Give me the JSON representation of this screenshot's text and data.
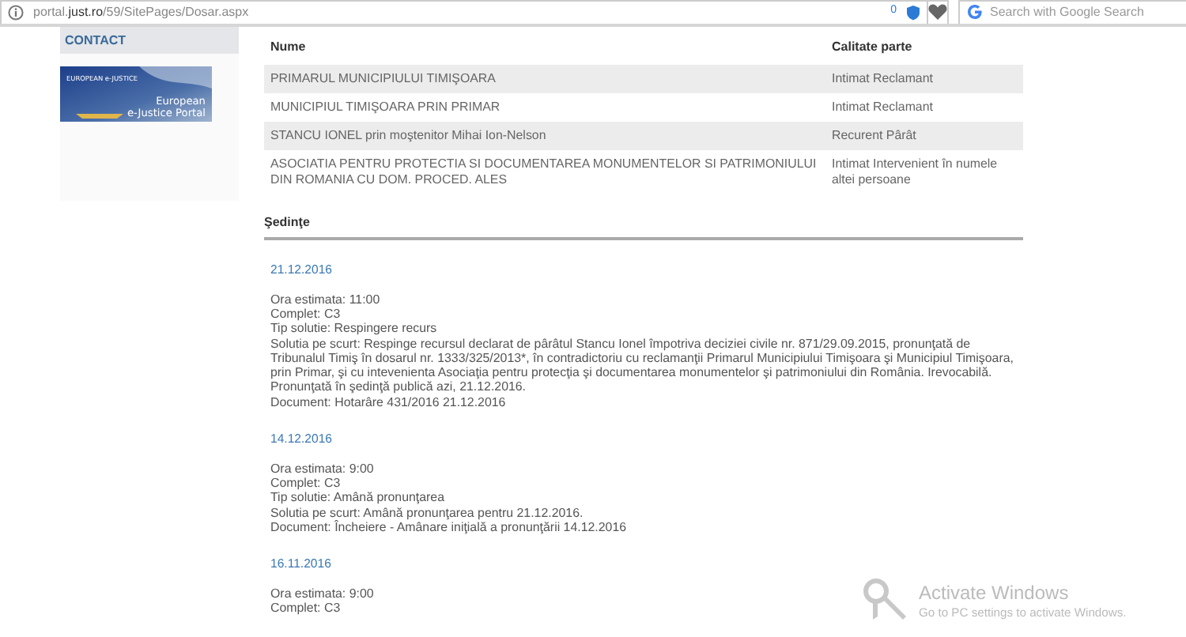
{
  "browser": {
    "url": "portal.**just.ro**/59/SitePages/Dosar.aspx",
    "badge_count": "0",
    "search_placeholder": "Search with Google Search"
  },
  "sidebar": {
    "heading": "CONTACT",
    "logo": {
      "small_text": "EUROPEAN e-JUSTICE",
      "title_line_1": "European",
      "title_line_2": "e-Justice Portal"
    }
  },
  "table": {
    "columns": [
      "Nume",
      "Calitate parte"
    ],
    "rows": [
      {
        "name": "PRIMARUL MUNICIPIULUI TIMIŞOARA",
        "role": "Intimat Reclamant"
      },
      {
        "name": "MUNICIPIUL TIMIŞOARA PRIN PRIMAR",
        "role": "Intimat Reclamant"
      },
      {
        "name": "STANCU IONEL prin moştenitor Mihai Ion-Nelson",
        "role": "Recurent Pârât"
      },
      {
        "name": "ASOCIATIA PENTRU PROTECTIA SI DOCUMENTAREA MONUMENTELOR SI PATRIMONIULUI DIN ROMANIA CU DOM. PROCED. ALES",
        "role": "Intimat Intervenient în numele altei persoane"
      }
    ]
  },
  "sessions_heading": "Şedinţe",
  "sessions": [
    {
      "date": "21.12.2016",
      "lines": [
        "Ora estimata: 11:00",
        "Complet: C3",
        "Tip solutie: Respingere recurs",
        "Solutia pe scurt: Respinge recursul declarat de pârâtul Stancu Ionel împotriva deciziei civile nr. 871/29.09.2015, pronunţată de Tribunalul Timiş în dosarul nr. 1333/325/2013*, în contradictoriu cu reclamanţii Primarul Municipiului Timişoara şi Municipiul Timişoara, prin Primar, şi cu intevenienta Asociaţia pentru protecţia şi documentarea monumentelor şi patrimoniului din România. Irevocabilă. Pronunţată în şedinţă publică azi, 21.12.2016.",
        "Document: Hotarâre  431/2016  21.12.2016"
      ]
    },
    {
      "date": "14.12.2016",
      "lines": [
        "Ora estimata: 9:00",
        "Complet: C3",
        "Tip solutie: Amână pronunţarea",
        "Solutia pe scurt: Amână pronunţarea pentru 21.12.2016.",
        "Document: Încheiere - Amânare iniţială a pronunţării    14.12.2016"
      ]
    },
    {
      "date": "16.11.2016",
      "lines": [
        "Ora estimata: 9:00",
        "Complet: C3"
      ]
    }
  ],
  "os_notice": {
    "title": "Activate Windows",
    "subtitle": "Go to PC settings to activate Windows."
  }
}
